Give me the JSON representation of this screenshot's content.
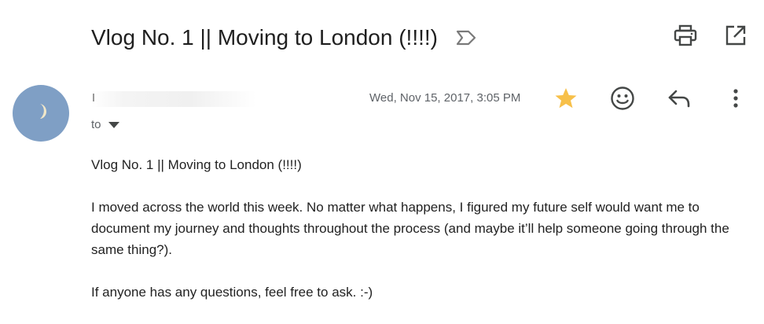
{
  "email": {
    "subject": "Vlog No. 1 || Moving to London (!!!!)",
    "date": "Wed, Nov 15, 2017, 3:05 PM",
    "recipient_label": "to",
    "starred": true,
    "body": {
      "heading": "Vlog No. 1 || Moving to London (!!!!)",
      "paragraph_1": "I moved across the world this week. No matter what happens, I figured my future self would want me to document my journey and thoughts throughout the process (and maybe it’ll help someone going through the same thing?).",
      "paragraph_2": "If anyone has any questions, feel free to ask. :-)"
    }
  },
  "icons": {
    "label": "label-arrow-icon",
    "print": "print-icon",
    "open_new_window": "open-in-new-window-icon",
    "avatar": "crescent-moon-icon",
    "star": "star-icon",
    "emoji": "emoji-reaction-icon",
    "reply": "reply-icon",
    "more": "more-vertical-icon",
    "caret": "caret-down-icon"
  },
  "colors": {
    "avatar_bg": "#7f9fc5",
    "star": "#f7c04a",
    "icon": "#444746",
    "meta_text": "#5f6368"
  }
}
